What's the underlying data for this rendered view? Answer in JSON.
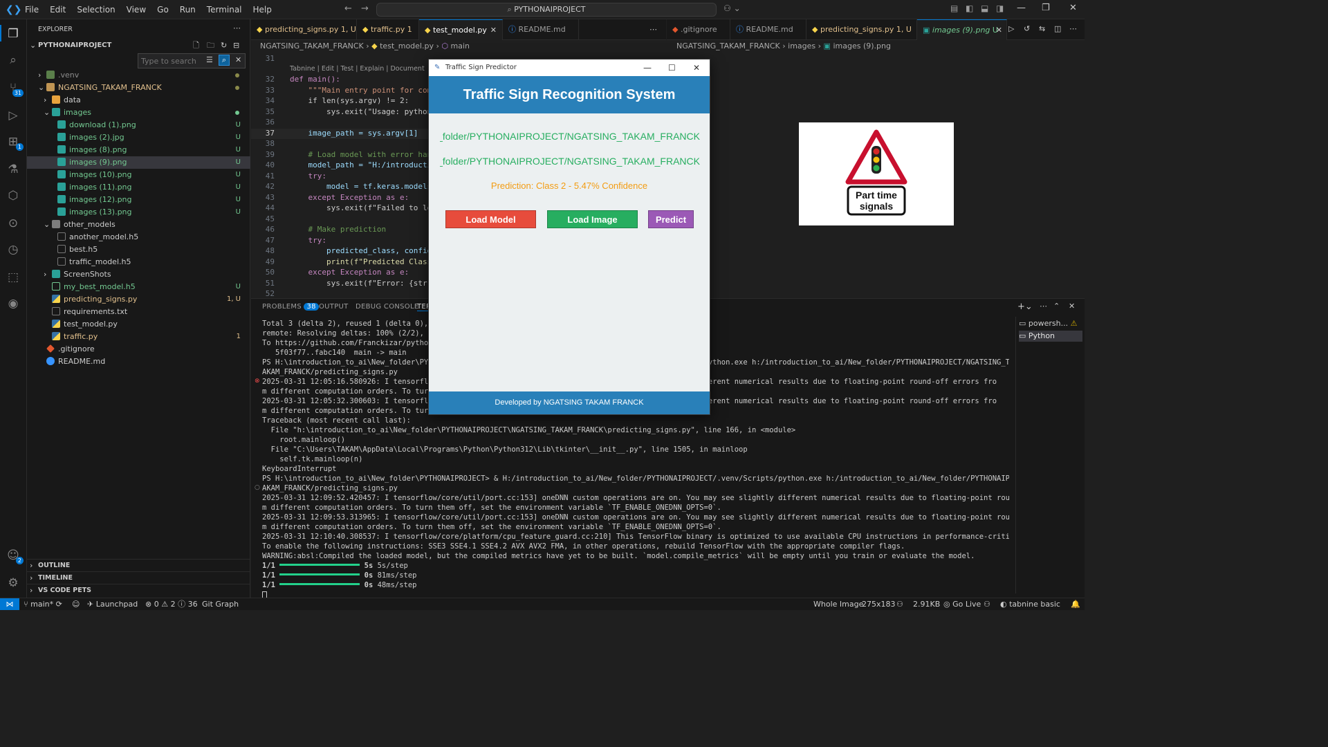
{
  "menu": [
    "File",
    "Edit",
    "Selection",
    "View",
    "Go",
    "Run",
    "Terminal",
    "Help"
  ],
  "command_center": "PYTHONAIPROJECT",
  "explorer": {
    "title": "EXPLORER",
    "root": "PYTHONAIPROJECT",
    "search_placeholder": "Type to search",
    "items": [
      {
        "label": ".venv",
        "status": ""
      },
      {
        "label": "NGATSING_TAKAM_FRANCK",
        "status": ""
      },
      {
        "label": "data",
        "status": ""
      },
      {
        "label": "images",
        "status": ""
      },
      {
        "label": "download (1).png",
        "status": "U"
      },
      {
        "label": "images (2).jpg",
        "status": "U"
      },
      {
        "label": "images (8).png",
        "status": "U"
      },
      {
        "label": "images (9).png",
        "status": "U"
      },
      {
        "label": "images (10).png",
        "status": "U"
      },
      {
        "label": "images (11).png",
        "status": "U"
      },
      {
        "label": "images (12).png",
        "status": "U"
      },
      {
        "label": "images (13).png",
        "status": "U"
      },
      {
        "label": "other_models",
        "status": ""
      },
      {
        "label": "another_model.h5",
        "status": ""
      },
      {
        "label": "best.h5",
        "status": ""
      },
      {
        "label": "traffic_model.h5",
        "status": ""
      },
      {
        "label": "ScreenShots",
        "status": ""
      },
      {
        "label": "my_best_model.h5",
        "status": "U"
      },
      {
        "label": "predicting_signs.py",
        "status": "1, U"
      },
      {
        "label": "requirements.txt",
        "status": ""
      },
      {
        "label": "test_model.py",
        "status": ""
      },
      {
        "label": "traffic.py",
        "status": "1"
      },
      {
        "label": ".gitignore",
        "status": ""
      },
      {
        "label": "README.md",
        "status": ""
      }
    ],
    "sections": [
      "OUTLINE",
      "TIMELINE",
      "VS CODE PETS"
    ]
  },
  "badges": {
    "source_control": "31",
    "extensions": "1",
    "accounts": "2"
  },
  "left_tabs": [
    {
      "label": "predicting_signs.py",
      "status": "1, U"
    },
    {
      "label": "traffic.py",
      "status": "1"
    },
    {
      "label": "test_model.py",
      "status": ""
    },
    {
      "label": "README.md",
      "status": ""
    }
  ],
  "left_breadcrumb": [
    "NGATSING_TAKAM_FRANCK",
    "test_model.py",
    "main"
  ],
  "right_tabs": [
    {
      "label": ".gitignore",
      "status": ""
    },
    {
      "label": "README.md",
      "status": ""
    },
    {
      "label": "predicting_signs.py",
      "status": "1, U"
    },
    {
      "label": "images (9).png",
      "status": "U"
    }
  ],
  "right_breadcrumb": [
    "NGATSING_TAKAM_FRANCK",
    "images",
    "images (9).png"
  ],
  "codelens": "Tabnine | Edit | Test | Explain | Document",
  "code_lines": [
    {
      "n": "31",
      "t": ""
    },
    {
      "n": "32",
      "t": "def main():"
    },
    {
      "n": "33",
      "t": "    \"\"\"Main entry point for comma"
    },
    {
      "n": "34",
      "t": "    if len(sys.argv) != 2:"
    },
    {
      "n": "35",
      "t": "        sys.exit(\"Usage: python t"
    },
    {
      "n": "36",
      "t": ""
    },
    {
      "n": "37",
      "t": "    image_path = sys.argv[1]"
    },
    {
      "n": "38",
      "t": ""
    },
    {
      "n": "39",
      "t": "    # Load model with error handl"
    },
    {
      "n": "40",
      "t": "    model_path = \"H:/introduction"
    },
    {
      "n": "41",
      "t": "    try:"
    },
    {
      "n": "42",
      "t": "        model = tf.keras.models.lo"
    },
    {
      "n": "43",
      "t": "    except Exception as e:"
    },
    {
      "n": "44",
      "t": "        sys.exit(f\"Failed to load"
    },
    {
      "n": "45",
      "t": ""
    },
    {
      "n": "46",
      "t": "    # Make prediction"
    },
    {
      "n": "47",
      "t": "    try:"
    },
    {
      "n": "48",
      "t": "        predicted_class, confiden"
    },
    {
      "n": "49",
      "t": "        print(f\"Predicted Class: "
    },
    {
      "n": "50",
      "t": "    except Exception as e:"
    },
    {
      "n": "51",
      "t": "        sys.exit(f\"Error: {str(e)"
    },
    {
      "n": "52",
      "t": ""
    }
  ],
  "sign": {
    "line1": "Part time",
    "line2": "signals"
  },
  "panel": {
    "tabs": [
      "PROBLEMS",
      "OUTPUT",
      "DEBUG CONSOLE",
      "TER"
    ],
    "problems_count": "38",
    "terminals": [
      "powersh...",
      "Python"
    ],
    "lines": [
      "Total 3 (delta 2), reused 1 (delta 0), pac",
      "remote: Resolving deltas: 100% (2/2), comp",
      "To https://github.com/Franckizar/pythonpro",
      "   5f03f77..fabc140  main -> main",
      "PS H:\\introduction_to_ai\\New_folder\\PYTHON                                                   Scripts/python.exe h:/introduction_to_ai/New_folder/PYTHONAIPROJECT/NGATSING_T",
      "AKAM_FRANCK/predicting_signs.py",
      "2025-03-31 12:05:16.580926: I tensorflow/c                                                   htly different numerical results due to floating-point round-off errors fro",
      "m different computation orders. To turn th",
      "2025-03-31 12:05:32.300603: I tensorflow/c                                                   htly different numerical results due to floating-point round-off errors fro",
      "m different computation orders. To turn th",
      "Traceback (most recent call last):",
      "  File \"h:\\introduction_to_ai\\New_folder\\PYTHONAIPROJECT\\NGATSING_TAKAM_FRANCK\\predicting_signs.py\", line 166, in <module>",
      "    root.mainloop()",
      "  File \"C:\\Users\\TAKAM\\AppData\\Local\\Programs\\Python\\Python312\\Lib\\tkinter\\__init__.py\", line 1505, in mainloop",
      "    self.tk.mainloop(n)",
      "KeyboardInterrupt",
      "PS H:\\introduction_to_ai\\New_folder\\PYTHONAIPROJECT> & H:/introduction_to_ai/New_folder/PYTHONAIPROJECT/.venv/Scripts/python.exe h:/introduction_to_ai/New_folder/PYTHONAIPROJECT/NGATSING_T",
      "AKAM_FRANCK/predicting_signs.py",
      "2025-03-31 12:09:52.420457: I tensorflow/core/util/port.cc:153] oneDNN custom operations are on. You may see slightly different numerical results due to floating-point round-off errors fro",
      "m different computation orders. To turn them off, set the environment variable `TF_ENABLE_ONEDNN_OPTS=0`.",
      "2025-03-31 12:09:53.313965: I tensorflow/core/util/port.cc:153] oneDNN custom operations are on. You may see slightly different numerical results due to floating-point round-off errors fro",
      "m different computation orders. To turn them off, set the environment variable `TF_ENABLE_ONEDNN_OPTS=0`.",
      "2025-03-31 12:10:40.308537: I tensorflow/core/platform/cpu_feature_guard.cc:210] This TensorFlow binary is optimized to use available CPU instructions in performance-critical operations.",
      "To enable the following instructions: SSE3 SSE4.1 SSE4.2 AVX AVX2 FMA, in other operations, rebuild TensorFlow with the appropriate compiler flags.",
      "WARNING:absl:Compiled the loaded model, but the compiled metrics have yet to be built. `model.compile_metrics` will be empty until you train or evaluate the model."
    ],
    "progress": [
      {
        "prefix": "1/1",
        "time": "5s",
        "rate": "5s/step"
      },
      {
        "prefix": "1/1",
        "time": "0s",
        "rate": "81ms/step"
      },
      {
        "prefix": "1/1",
        "time": "0s",
        "rate": "48ms/step"
      }
    ]
  },
  "app": {
    "window_title": "Traffic Sign Predictor",
    "header": "Traffic Sign Recognition System",
    "model_path": "H:/introduction_to_ai/New_folder/PYTHONAIPROJECT/NGATSING_TAKAM_FRANCK",
    "image_path": "H:/introduction_to_ai/New_folder/PYTHONAIPROJECT/NGATSING_TAKAM_FRANCK",
    "prediction": "Prediction: Class 2 - 5.47% Confidence",
    "buttons": {
      "load_model": "Load Model",
      "load_image": "Load Image",
      "predict": "Predict"
    },
    "footer": "Developed by NGATSING TAKAM FRANCK",
    "colors": {
      "header": "#2980b9",
      "load_model": "#e74c3c",
      "load_image": "#27ae60",
      "predict": "#9b59b6",
      "prediction_text": "#f39c12"
    }
  },
  "status": {
    "branch": "main*",
    "launchpad": "Launchpad",
    "errors": "0",
    "warnings": "2",
    "infos": "36",
    "git_graph": "Git Graph",
    "whole_image": "Whole Image",
    "dimensions": "275x183",
    "size": "2.91KB",
    "go_live": "Go Live",
    "tabnine": "tabnine basic"
  }
}
